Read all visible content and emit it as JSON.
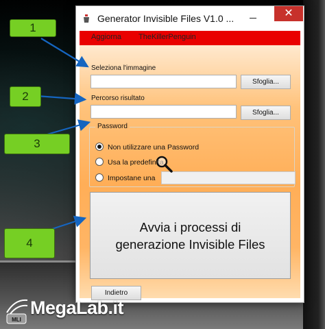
{
  "window": {
    "title": "Generator Invisible Files V1.0 ...",
    "close_glyph": "✕",
    "menu": [
      "Aggiorna",
      "TheKillerPenguin"
    ]
  },
  "form": {
    "image_label": "Seleziona l'immagine",
    "image_value": "",
    "browse_label": "Sfoglia...",
    "output_label": "Percorso risultato",
    "output_value": "",
    "password_group_title": "Password",
    "password_options": [
      {
        "label": "Non utilizzare una Password",
        "checked": true
      },
      {
        "label": "Usa la predefinita",
        "checked": false
      },
      {
        "label": "Impostane una",
        "checked": false
      }
    ],
    "custom_password_value": "",
    "run_button_lines": [
      "Avvia i processi di",
      "generazione Invisible Files"
    ],
    "back_button": "Indietro"
  },
  "callouts": [
    "1",
    "2",
    "3",
    "4"
  ],
  "colors": {
    "menubar": "#e90000",
    "close_button": "#c7312b",
    "callout": "#76cf24",
    "arrow": "#1565c0",
    "gradient_mid": "#ffae57"
  },
  "icons": [
    "app-icon",
    "close-icon",
    "minimize-icon",
    "magnifier-icon",
    "megalab-logo-icon"
  ],
  "watermark": {
    "text": "MegaLab.it",
    "badge": "MLI"
  }
}
